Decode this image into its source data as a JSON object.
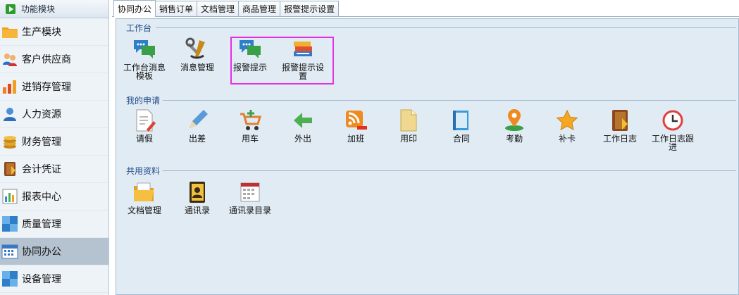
{
  "sidebar": {
    "header": "功能模块",
    "items": [
      {
        "label": "生产模块",
        "icon": "folder-icon"
      },
      {
        "label": "客户供应商",
        "icon": "users-icon"
      },
      {
        "label": "进销存管理",
        "icon": "bar-chart-icon"
      },
      {
        "label": "人力资源",
        "icon": "person-icon"
      },
      {
        "label": "财务管理",
        "icon": "coins-icon"
      },
      {
        "label": "会计凭证",
        "icon": "ledger-icon"
      },
      {
        "label": "报表中心",
        "icon": "report-icon"
      },
      {
        "label": "质量管理",
        "icon": "quality-icon"
      },
      {
        "label": "协同办公",
        "icon": "calendar-icon",
        "active": true
      },
      {
        "label": "设备管理",
        "icon": "device-icon"
      }
    ]
  },
  "tabs": [
    "协同办公",
    "销售订单",
    "文档管理",
    "商品管理",
    "报警提示设置"
  ],
  "groups": {
    "workbench": {
      "title": "工作台",
      "items": [
        "工作台消息模板",
        "消息管理",
        "报警提示",
        "报警提示设置"
      ]
    },
    "applications": {
      "title": "我的申请",
      "items": [
        "请假",
        "出差",
        "用车",
        "外出",
        "加班",
        "用印",
        "合同",
        "考勤",
        "补卡",
        "工作日志",
        "工作日志跟进"
      ]
    },
    "shared": {
      "title": "共用资料",
      "items": [
        "文档管理",
        "通讯录",
        "通讯录目录"
      ]
    }
  },
  "colors": {
    "highlight": "#e62ee6",
    "content_bg": "#e0ebf3",
    "active_sidebar": "#b5c2cf"
  }
}
